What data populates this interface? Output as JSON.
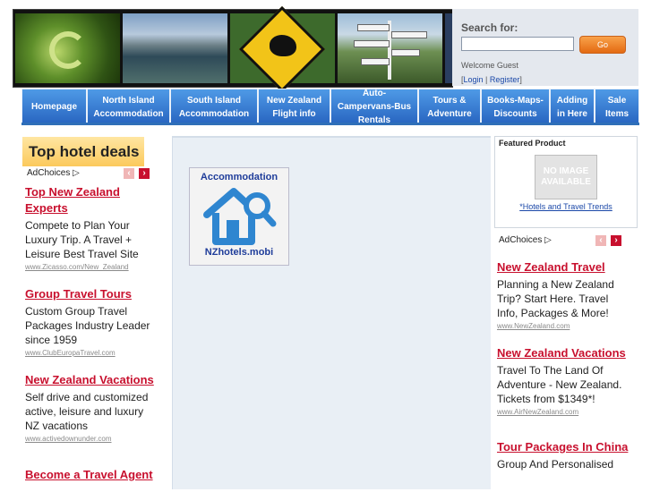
{
  "search": {
    "label": "Search for:",
    "placeholder": "",
    "button": "Go"
  },
  "account": {
    "welcome": "Welcome Guest",
    "login": "Login",
    "sep": " | ",
    "register": "Register"
  },
  "nav": [
    "Homepage",
    "North Island\nAccommodation",
    "South Island\nAccommodation",
    "New Zealand\nFlight info",
    "Auto-\nCampervans-Bus\nRentals",
    "Tours &\nAdventure",
    "Books-Maps-\nDiscounts",
    "Adding\nin Here",
    "Sale\nItems"
  ],
  "sidebar": {
    "heading": "Top hotel deals"
  },
  "ads_common": {
    "adchoices": "AdChoices",
    "prev": "‹",
    "next": "›"
  },
  "left_ads": [
    {
      "title": "Top New Zealand Experts",
      "body": "Compete to Plan Your Luxury Trip. A Travel + Leisure Best Travel Site",
      "url": "www.Zicasso.com/New_Zealand"
    },
    {
      "title": "Group Travel Tours",
      "body": "Custom Group Travel Packages Industry Leader since 1959",
      "url": "www.ClubEuropaTravel.com"
    },
    {
      "title": "New Zealand Vacations",
      "body": "Self drive and customized active, leisure and luxury NZ vacations",
      "url": "www.activedownunder.com"
    },
    {
      "title": "Become a Travel Agent",
      "body": "",
      "url": ""
    }
  ],
  "logo": {
    "top": "Accommodation",
    "bottom": "NZhotels.mobi"
  },
  "featured": {
    "title": "Featured Product",
    "no_image": "NO IMAGE AVAILABLE",
    "link": "*Hotels and Travel Trends"
  },
  "right_ads": [
    {
      "title": "New Zealand Travel",
      "body": "Planning a New Zealand Trip? Start Here. Travel Info, Packages & More!",
      "url": "www.NewZealand.com"
    },
    {
      "title": "New Zealand Vacations",
      "body": "Travel To The Land Of Adventure - New Zealand. Tickets from $1349*!",
      "url": "www.AirNewZealand.com"
    },
    {
      "title": "Tour Packages In China",
      "body": "Group And Personalised",
      "url": ""
    }
  ]
}
